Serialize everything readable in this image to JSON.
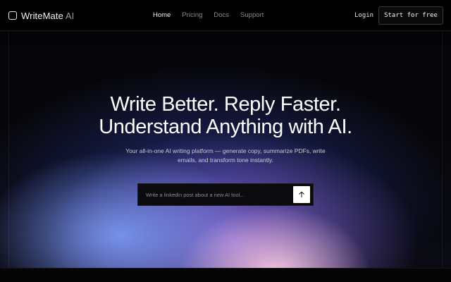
{
  "brand": {
    "name": "WriteMate",
    "suffix": "AI",
    "logo_icon": "rounded-square-outline-icon"
  },
  "nav": {
    "links": [
      {
        "label": "Home",
        "active": true
      },
      {
        "label": "Pricing",
        "active": false
      },
      {
        "label": "Docs",
        "active": false
      },
      {
        "label": "Support",
        "active": false
      }
    ],
    "login_label": "Login",
    "cta_label": "Start for free"
  },
  "hero": {
    "headline_line1": "Write Better. Reply Faster.",
    "headline_line2": "Understand Anything with AI.",
    "subtitle": "Your all-in-one AI writing platform — generate copy, summarize PDFs, write emails, and transform tone instantly.",
    "prompt": {
      "placeholder": "Write a linkedin post about a new AI tool...",
      "value": "",
      "send_icon": "arrow-up-icon"
    }
  },
  "colors": {
    "background": "#07070a",
    "accent_blue": "#7896f0",
    "accent_pink": "#ffcde1",
    "text_primary": "#ffffff",
    "text_muted": "#8a8a90"
  }
}
